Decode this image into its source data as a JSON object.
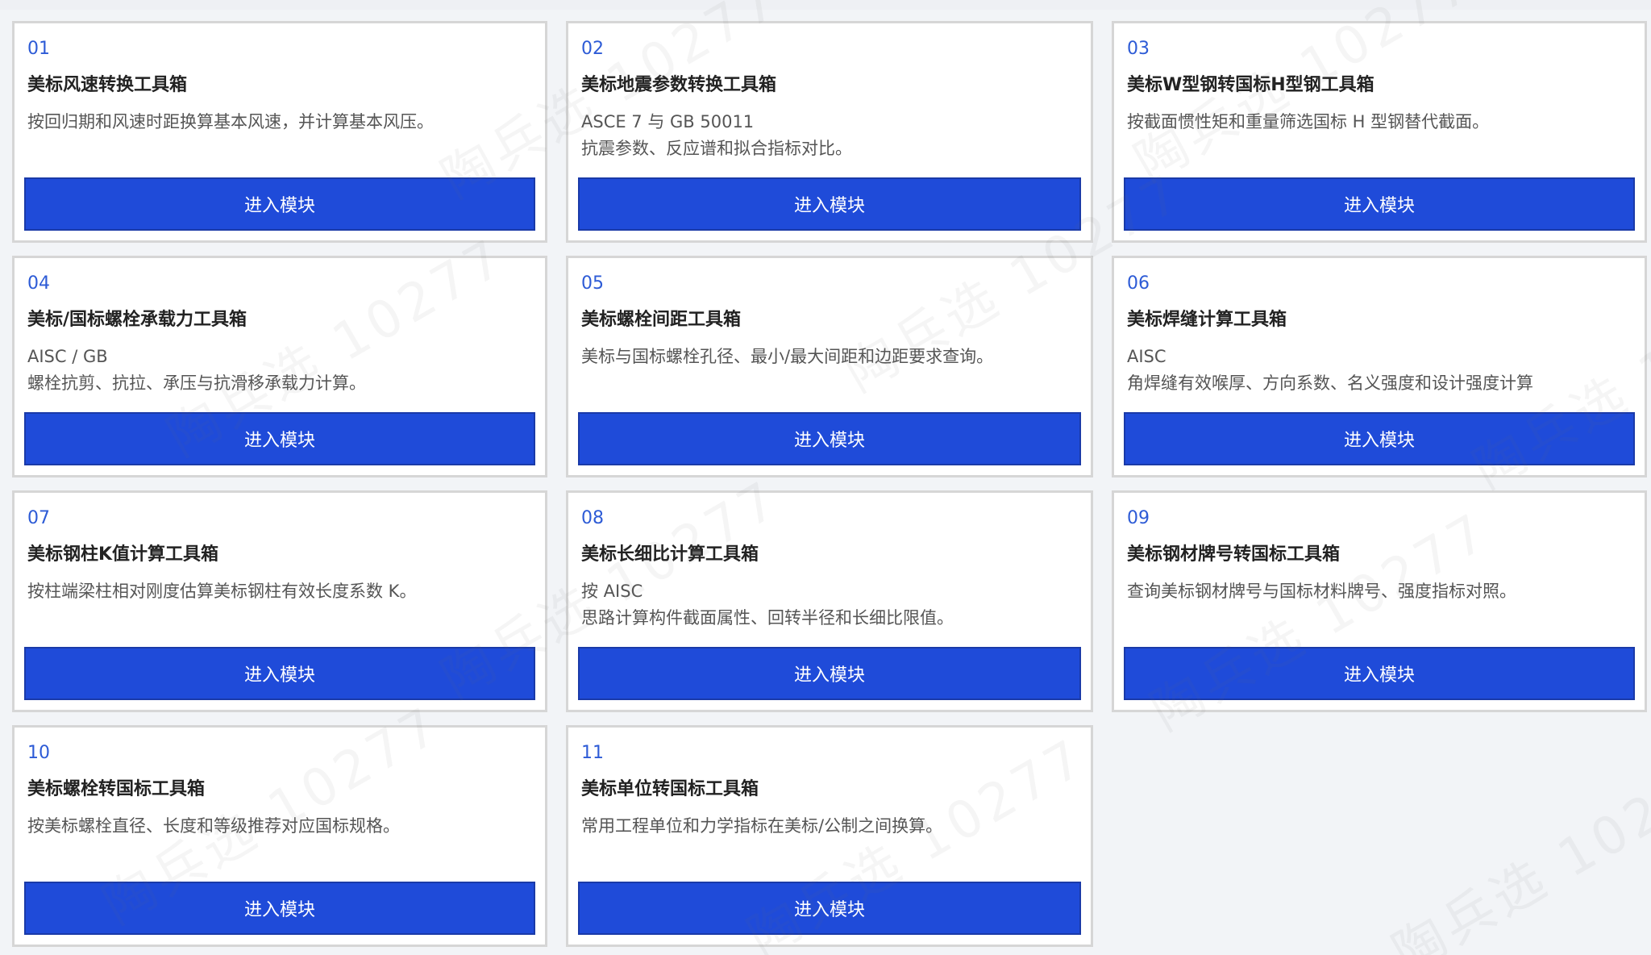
{
  "button_label": "进入模块",
  "watermark_text": "陶兵选 10277",
  "modules": [
    {
      "num": "01",
      "title": "美标风速转换工具箱",
      "desc": "按回归期和风速时距换算基本风速，并计算基本风压。"
    },
    {
      "num": "02",
      "title": "美标地震参数转换工具箱",
      "desc": "ASCE 7 与 GB 50011\n抗震参数、反应谱和拟合指标对比。"
    },
    {
      "num": "03",
      "title": "美标W型钢转国标H型钢工具箱",
      "desc": "按截面惯性矩和重量筛选国标 H 型钢替代截面。"
    },
    {
      "num": "04",
      "title": "美标/国标螺栓承载力工具箱",
      "desc": "AISC / GB\n螺栓抗剪、抗拉、承压与抗滑移承载力计算。"
    },
    {
      "num": "05",
      "title": "美标螺栓间距工具箱",
      "desc": "美标与国标螺栓孔径、最小/最大间距和边距要求查询。"
    },
    {
      "num": "06",
      "title": "美标焊缝计算工具箱",
      "desc": "AISC\n角焊缝有效喉厚、方向系数、名义强度和设计强度计算"
    },
    {
      "num": "07",
      "title": "美标钢柱K值计算工具箱",
      "desc": "按柱端梁柱相对刚度估算美标钢柱有效长度系数 K。"
    },
    {
      "num": "08",
      "title": "美标长细比计算工具箱",
      "desc": "按 AISC\n思路计算构件截面属性、回转半径和长细比限值。"
    },
    {
      "num": "09",
      "title": "美标钢材牌号转国标工具箱",
      "desc": "查询美标钢材牌号与国标材料牌号、强度指标对照。"
    },
    {
      "num": "10",
      "title": "美标螺栓转国标工具箱",
      "desc": "按美标螺栓直径、长度和等级推荐对应国标规格。"
    },
    {
      "num": "11",
      "title": "美标单位转国标工具箱",
      "desc": "常用工程单位和力学指标在美标/公制之间换算。"
    }
  ]
}
